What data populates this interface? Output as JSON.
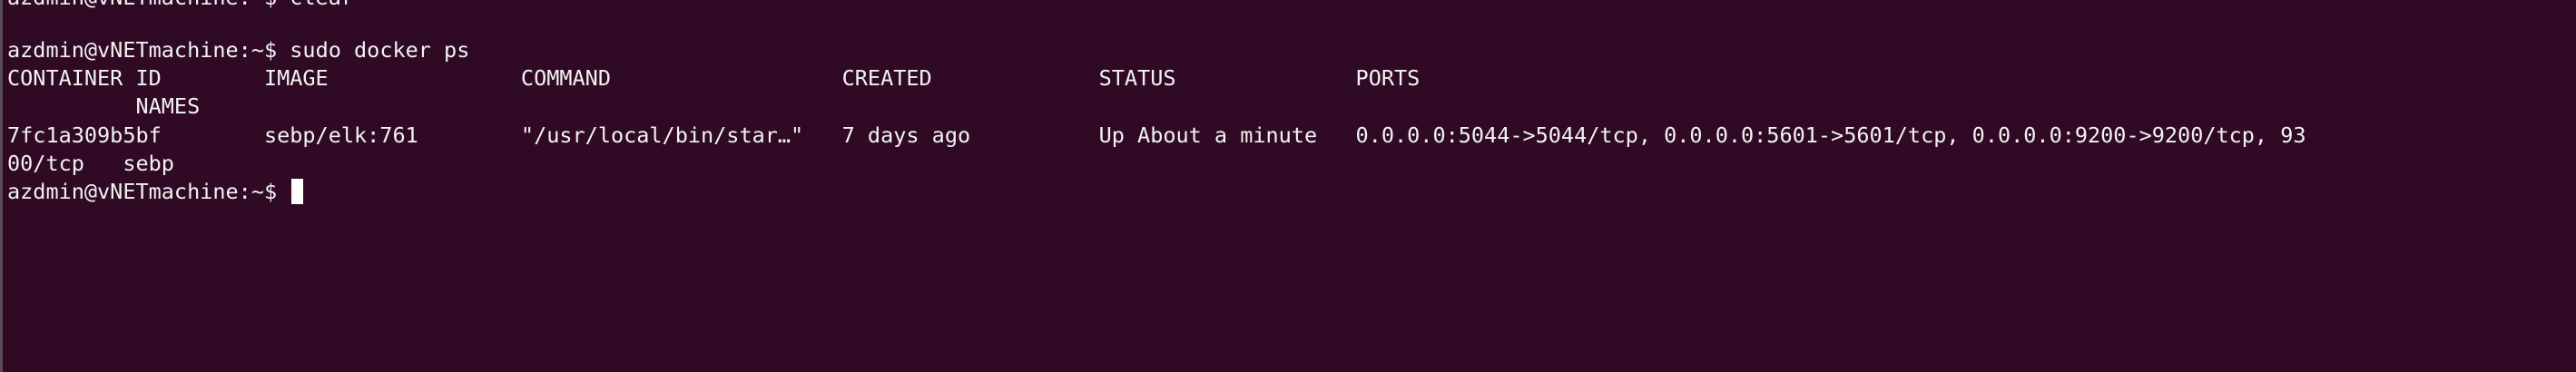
{
  "terminal": {
    "cut_line": "azdmin@vNETmachine:~$ clear",
    "prompt": "azdmin@vNETmachine:~$",
    "command": "sudo docker ps",
    "header_line1": "CONTAINER ID        IMAGE               COMMAND                  CREATED             STATUS              PORTS",
    "header_line2": "          NAMES",
    "row_line1": "7fc1a309b5bf        sebp/elk:761        \"/usr/local/bin/star…\"   7 days ago          Up About a minute   0.0.0.0:5044->5044/tcp, 0.0.0.0:5601->5601/tcp, 0.0.0.0:9200->9200/tcp, 93",
    "row_line2": "00/tcp   sebp",
    "final_prompt": "azdmin@vNETmachine:~$"
  },
  "colors": {
    "background": "#300a24",
    "foreground": "#f2f2f2",
    "cursor": "#ffffff"
  }
}
